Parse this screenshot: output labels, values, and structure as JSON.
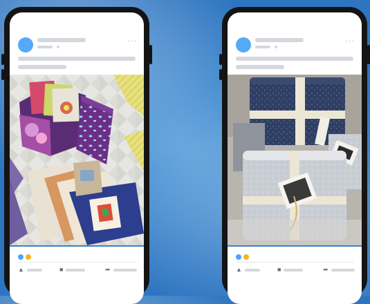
{
  "colors": {
    "avatar": "#55aaf7",
    "accent_line": "#3b82c4",
    "react_like": "#4aa6ff",
    "react_love": "#f6b51f"
  },
  "icons": {
    "more": "more-icon",
    "like": "like-icon",
    "comment": "comment-icon",
    "share": "share-icon"
  },
  "posts": [
    {
      "photo": "fabric-box-and-quilt-patterns"
    },
    {
      "photo": "stacked-fabric-bundles"
    }
  ]
}
